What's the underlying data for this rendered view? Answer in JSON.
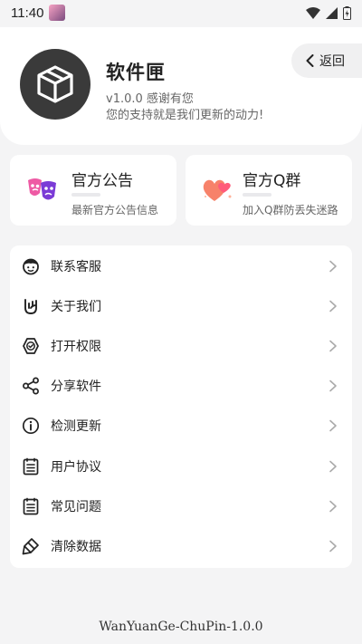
{
  "status_bar": {
    "time": "11:40"
  },
  "header": {
    "app_name": "软件匣",
    "version_line": "v1.0.0  感谢有您",
    "slogan": "您的支持就是我们更新的动力!",
    "back_label": "返回"
  },
  "cards": [
    {
      "title": "官方公告",
      "subtitle": "最新官方公告信息",
      "icon": "theater-masks-icon"
    },
    {
      "title": "官方Q群",
      "subtitle": "加入Q群防丢失迷路",
      "icon": "hearts-icon"
    }
  ],
  "menu": [
    {
      "label": "联系客服",
      "icon": "face-icon"
    },
    {
      "label": "关于我们",
      "icon": "hand-icon"
    },
    {
      "label": "打开权限",
      "icon": "shield-check-icon"
    },
    {
      "label": "分享软件",
      "icon": "share-icon"
    },
    {
      "label": "检测更新",
      "icon": "info-icon"
    },
    {
      "label": "用户协议",
      "icon": "document-icon"
    },
    {
      "label": "常见问题",
      "icon": "document-icon"
    },
    {
      "label": "清除数据",
      "icon": "eraser-icon"
    }
  ],
  "footer": {
    "version": "WanYuanGe-ChuPin-1.0.0"
  }
}
